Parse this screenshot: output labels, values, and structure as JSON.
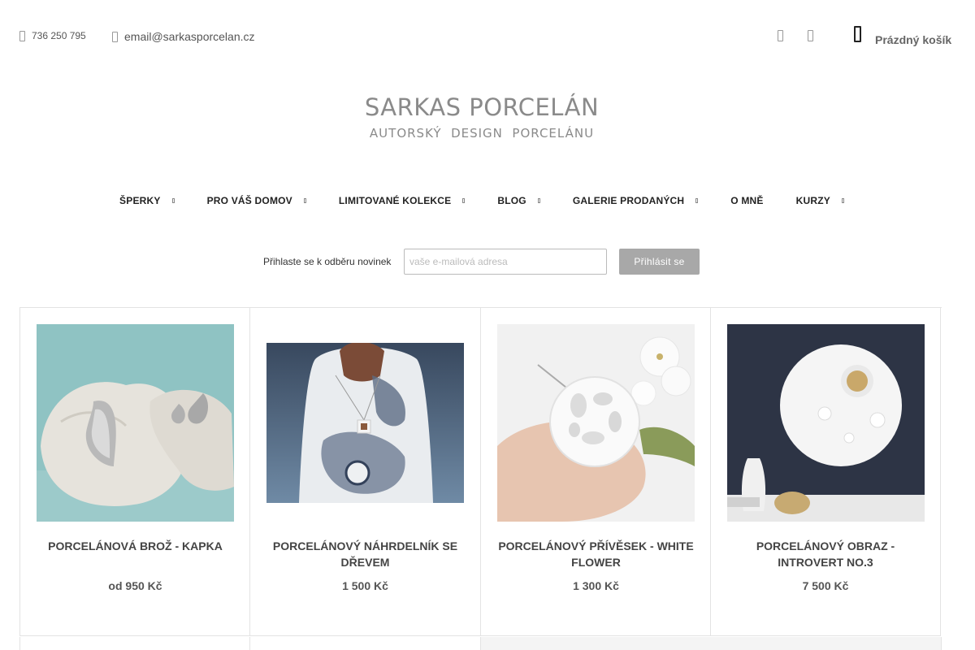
{
  "contact": {
    "phone": "736 250 795",
    "email": "email@sarkasporcelan.cz"
  },
  "cart": {
    "label": "Prázdný košík"
  },
  "logo": {
    "title": "SARKAS PORCELÁN",
    "subtitle": "AUTORSKÝ  DESIGN  PORCELÁNU"
  },
  "nav": {
    "items": [
      {
        "label": "ŠPERKY",
        "has_dropdown": true
      },
      {
        "label": "PRO VÁŠ DOMOV",
        "has_dropdown": true
      },
      {
        "label": "LIMITOVANÉ KOLEKCE",
        "has_dropdown": true
      },
      {
        "label": "BLOG",
        "has_dropdown": true
      },
      {
        "label": "GALERIE PRODANÝCH",
        "has_dropdown": true
      },
      {
        "label": "O MNĚ",
        "has_dropdown": false
      },
      {
        "label": "KURZY",
        "has_dropdown": true
      }
    ]
  },
  "newsletter": {
    "label": "Přihlaste se k odběru novinek",
    "placeholder": "vaše e-mailová adresa",
    "button": "Přihlásit se"
  },
  "products": [
    {
      "name": "PORCELÁNOVÁ BROŽ - KAPKA",
      "price": "od 950 Kč"
    },
    {
      "name": "PORCELÁNOVÝ NÁHRDELNÍK SE DŘEVEM",
      "price": "1 500 Kč"
    },
    {
      "name": "PORCELÁNOVÝ PŘÍVĚSEK - WHITE FLOWER",
      "price": "1 300 Kč"
    },
    {
      "name": "PORCELÁNOVÝ OBRAZ - INTROVERT NO.3",
      "price": "7 500 Kč"
    }
  ]
}
